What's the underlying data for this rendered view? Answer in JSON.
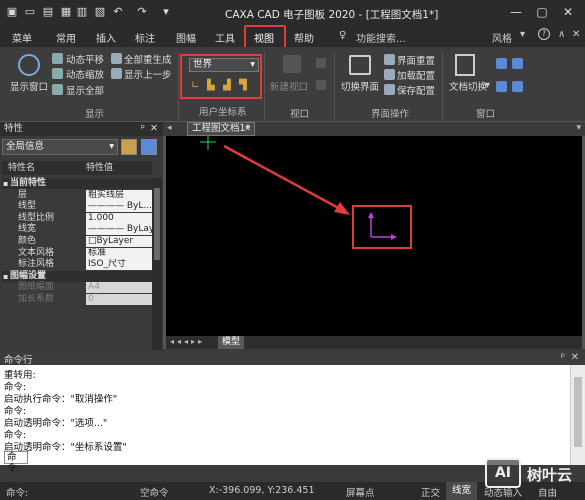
{
  "app": {
    "title": "CAXA CAD 电子图板 2020 - [工程图文档1*]"
  },
  "menu_tabs": [
    "菜单",
    "常用",
    "插入",
    "标注",
    "图幅",
    "工具",
    "视图",
    "帮助"
  ],
  "active_tab": "视图",
  "search": {
    "label": "功能搜索..."
  },
  "style_menu": {
    "label": "风格"
  },
  "ribbon": {
    "display_window": "显示窗口",
    "pan": "动态平移",
    "zoom": "动态缩放",
    "show_all": "显示全部",
    "regen_all": "全部重生成",
    "prev_view": "显示上一步",
    "group_display": "显示",
    "ucs_value": "世界",
    "group_ucs": "用户坐标系",
    "new_viewport": "新建视口",
    "group_viewport": "视口",
    "switch_ui": "切换界面",
    "reset_ui": "界面重置",
    "load_config": "加载配置",
    "save_config": "保存配置",
    "group_ui_ops": "界面操作",
    "doc_switch": "文档切换",
    "group_window": "窗口"
  },
  "properties": {
    "title": "特性",
    "filter": "全局信息",
    "col_name": "特性名",
    "col_value": "特性值",
    "rows": [
      {
        "k": "当前特性",
        "v": "",
        "section": true
      },
      {
        "k": "层",
        "v": "粗实线层"
      },
      {
        "k": "线型",
        "v": "———— ByL..."
      },
      {
        "k": "线型比例",
        "v": "1.000"
      },
      {
        "k": "线宽",
        "v": "———— ByLayer"
      },
      {
        "k": "颜色",
        "v": "□ByLayer"
      },
      {
        "k": "文本风格",
        "v": "标准"
      },
      {
        "k": "标注风格",
        "v": "ISO_尺寸"
      },
      {
        "k": "图幅设置",
        "v": "",
        "section": true
      },
      {
        "k": "图纸幅面",
        "v": "A4",
        "disabled": true
      },
      {
        "k": "加长系数",
        "v": "0",
        "disabled": true
      }
    ]
  },
  "document": {
    "tab": "工程图文档1*",
    "model_tab": "模型"
  },
  "command": {
    "title": "命令行",
    "lines": [
      "重转用:",
      "命令:",
      "启动执行命令：\"取消操作\"",
      "命令:",
      "启动透明命令：\"选项...\"",
      "命令:",
      "启动透明命令：\"坐标系设置\""
    ],
    "prompt": "命令:"
  },
  "status": {
    "command": "命令:",
    "empty_command": "空命令",
    "coords": "X:-396.099, Y:236.451",
    "snap": "屏幕点",
    "ortho": "正交",
    "lineweight": "线宽",
    "dynamic": "动态输入",
    "free": "自由"
  },
  "watermark": {
    "text": "树叶云",
    "logo": "AI"
  },
  "colors": {
    "accent_red": "#e23b3b",
    "ucs_purple": "#c040e0",
    "bg_dark": "#2b2b2b"
  }
}
